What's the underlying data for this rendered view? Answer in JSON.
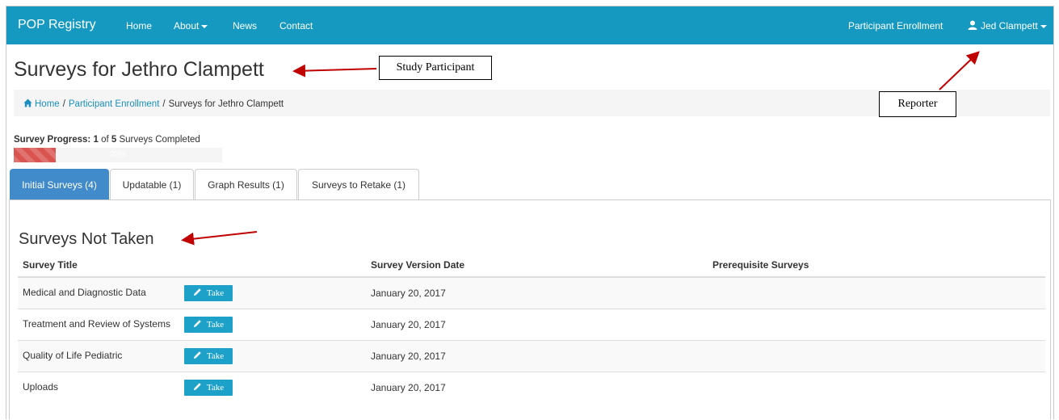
{
  "navbar": {
    "brand": "POP Registry",
    "links": {
      "home": "Home",
      "about": "About",
      "news": "News",
      "contact": "Contact"
    },
    "right": {
      "enrollment": "Participant Enrollment",
      "user": "Jed Clampett"
    }
  },
  "page": {
    "title": "Surveys for Jethro Clampett"
  },
  "breadcrumb": {
    "home": "Home",
    "enrollment": "Participant Enrollment",
    "current": "Surveys for Jethro Clampett",
    "separator": "/"
  },
  "progress": {
    "label_prefix": "Survey Progress:",
    "completed": "1",
    "of_text": "of",
    "total": "5",
    "suffix": "Surveys Completed",
    "percent_text": "20%",
    "fraction": 0.2
  },
  "tabs": [
    {
      "label": "Initial Surveys (4)",
      "active": true
    },
    {
      "label": "Updatable (1)",
      "active": false
    },
    {
      "label": "Graph Results (1)",
      "active": false
    },
    {
      "label": "Surveys to Retake (1)",
      "active": false
    }
  ],
  "section": {
    "title": "Surveys Not Taken"
  },
  "table": {
    "headers": [
      "Survey Title",
      "Survey Version Date",
      "Prerequisite Surveys"
    ],
    "take_label": "Take",
    "rows": [
      {
        "title": "Medical and Diagnostic Data",
        "date": "January 20, 2017",
        "prereq": ""
      },
      {
        "title": "Treatment and Review of Systems",
        "date": "January 20, 2017",
        "prereq": ""
      },
      {
        "title": "Quality of Life Pediatric",
        "date": "January 20, 2017",
        "prereq": ""
      },
      {
        "title": "Uploads",
        "date": "January 20, 2017",
        "prereq": ""
      }
    ]
  },
  "annotations": {
    "study_participant": "Study Participant",
    "reporter": "Reporter"
  },
  "colors": {
    "navbar": "#1599c0",
    "tab_active": "#428bca",
    "progress": "#d9534f",
    "take_button": "#1da1c8",
    "link": "#1a8fc0",
    "annotation_arrow": "#c00000"
  }
}
